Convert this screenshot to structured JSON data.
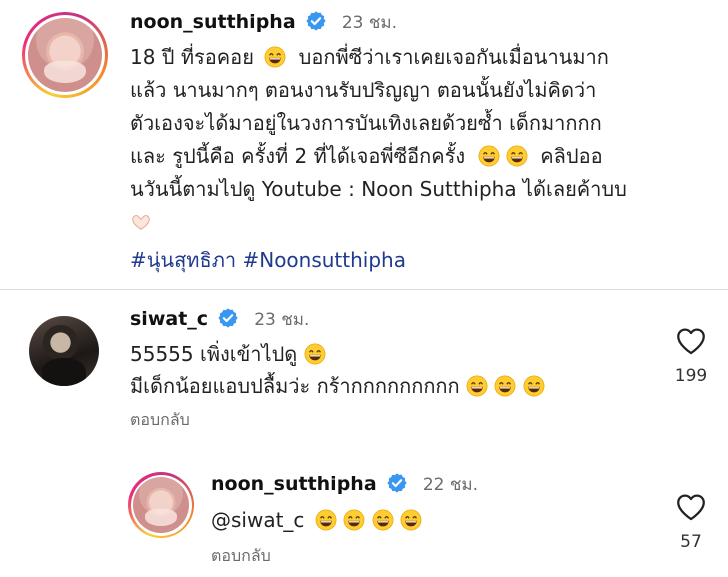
{
  "post": {
    "username": "noon_sutthipha",
    "time": "23 ชม.",
    "caption_lines": [
      "18 ปี ที่รอคอย",
      "บอกพี่ซีว่าเราเคยเจอกันเมื่อนานมาก",
      "แล้ว นานมากๆ ตอนงานรับปริญญา ตอนนั้นยังไม่คิดว่า",
      "ตัวเองจะได้มาอยู่ในวงการบันเทิงเลยด้วยซ้ำ เด็กมากกก",
      "และ รูปนี้คือ ครั้งที่ 2 ที่ได้เจอพี่ซีอีกครั้ง",
      "คลิปออ",
      "นวันนี้ตามไปดู Youtube : Noon Sutthipha ได้เลยค้าบบ"
    ],
    "hashtags": "#นุ่นสุทธิภา #Noonsutthipha"
  },
  "comments": [
    {
      "username": "siwat_c",
      "time": "23 ชม.",
      "line1": "55555 เพิ่งเข้าไปดู",
      "line2": "มีเด็กน้อยแอบปลื้มว่ะ กร้ากกกกกกกกก",
      "reply_label": "ตอบกลับ",
      "likes": "199"
    },
    {
      "username": "noon_sutthipha",
      "time": "22 ชม.",
      "text": "@siwat_c",
      "reply_label": "ตอบกลับ",
      "likes": "57"
    }
  ],
  "colors": {
    "hashtag": "#1f3a8f",
    "verified": "#3897f0",
    "muted": "#6b6b6b"
  },
  "icons": [
    "verified-badge-icon",
    "grinning-emoji-icon",
    "heart-hands-emoji-icon",
    "heart-outline-icon"
  ]
}
